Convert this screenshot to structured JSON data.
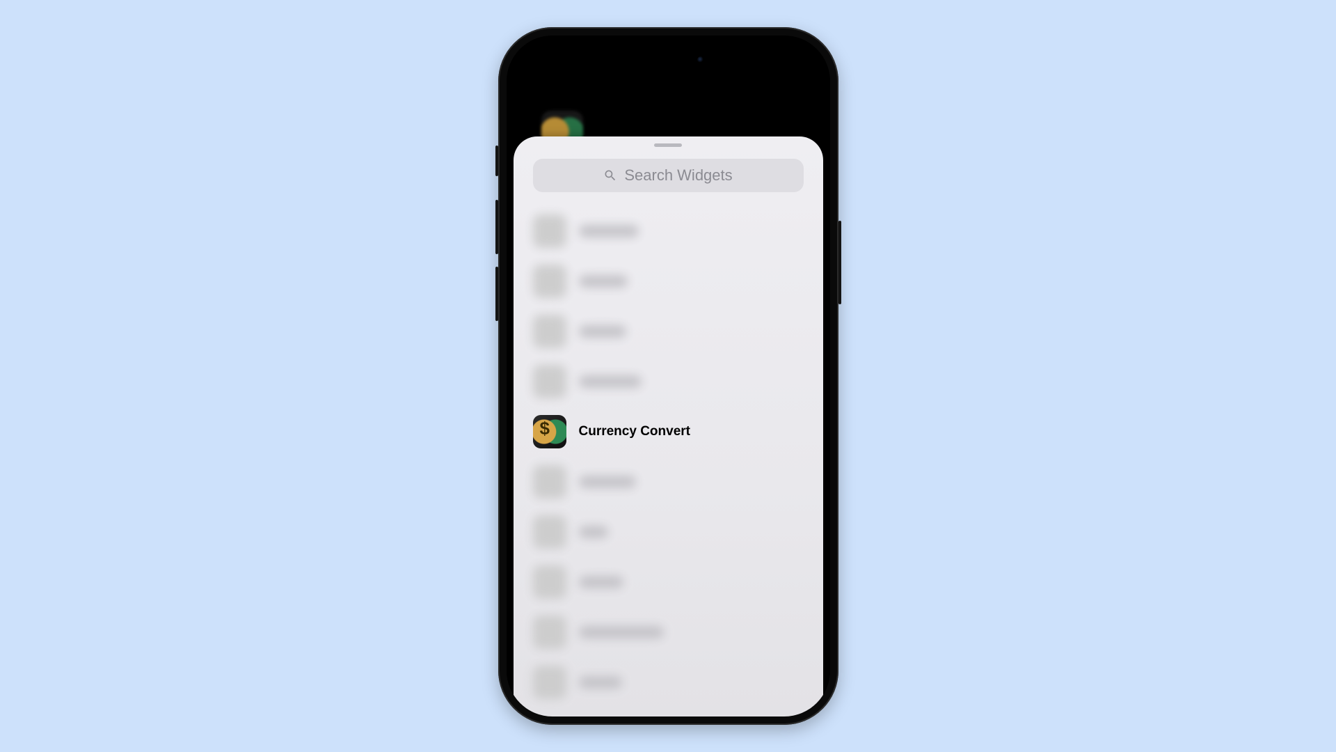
{
  "search": {
    "placeholder": "Search Widgets"
  },
  "focused": {
    "label": "Currency Convert",
    "icon_name": "currency-convert-app-icon"
  },
  "blurred_rows": [
    {
      "icon_class": "ic-green",
      "label_width": 86
    },
    {
      "icon_class": "ic-grey",
      "label_width": 70
    },
    {
      "icon_class": "ic-orange",
      "label_width": 68
    },
    {
      "icon_class": "ic-indigo",
      "label_width": 90
    },
    {
      "icon_class": "ic-blue1",
      "label_width": 82
    },
    {
      "icon_class": "ic-multi",
      "label_width": 42
    },
    {
      "icon_class": "ic-blue2",
      "label_width": 64
    },
    {
      "icon_class": "ic-white",
      "label_width": 122
    },
    {
      "icon_class": "ic-yellow",
      "label_width": 62
    }
  ]
}
